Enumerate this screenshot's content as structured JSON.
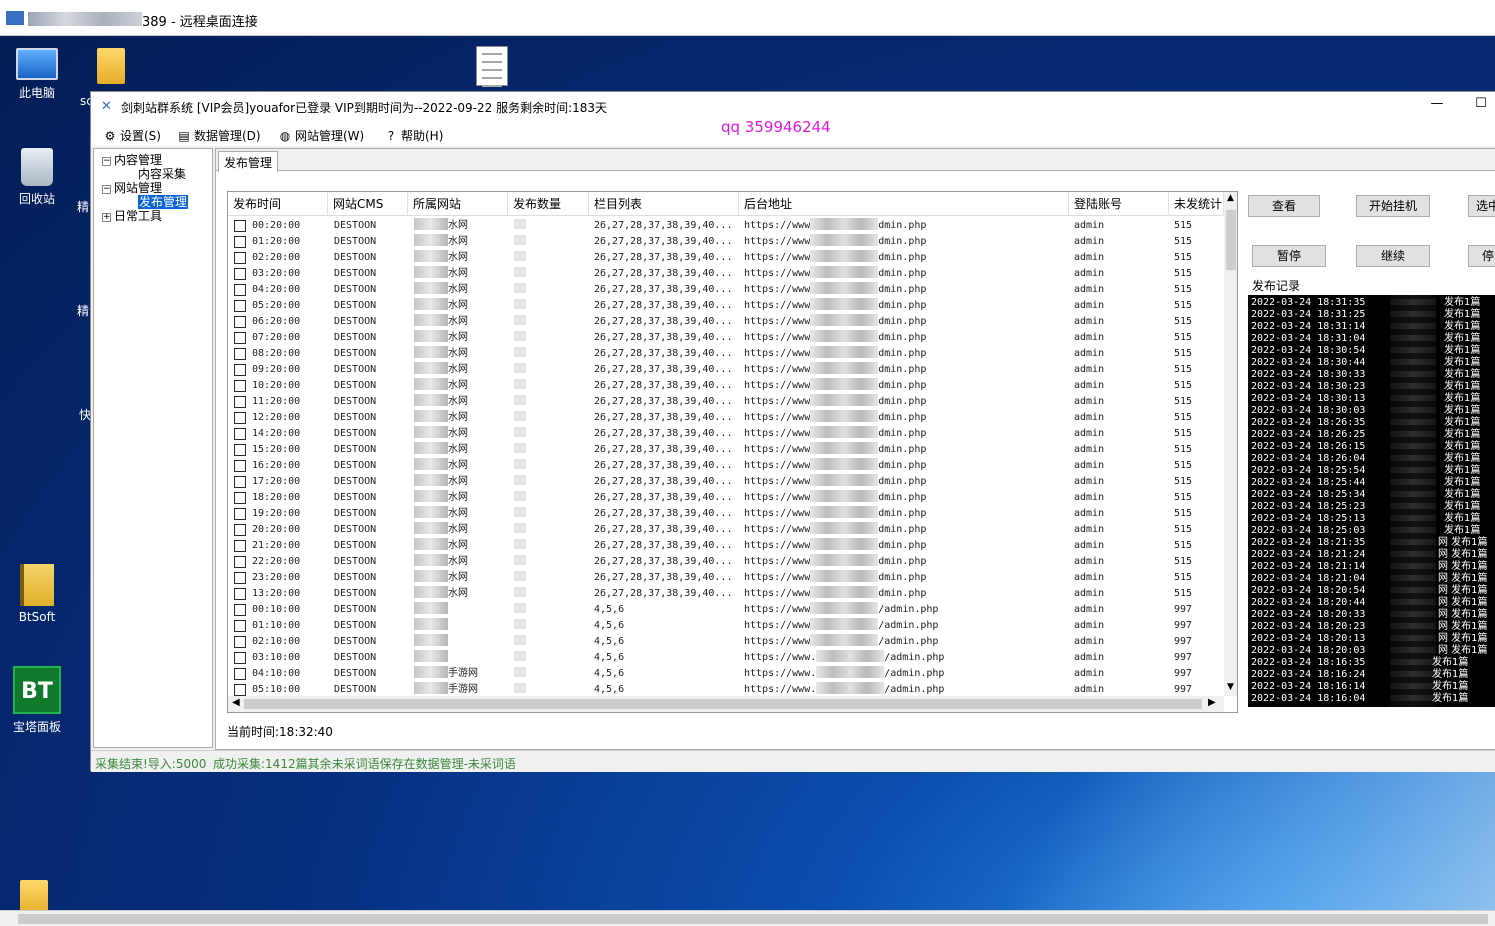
{
  "remote": {
    "title_suffix": "389 - 远程桌面连接"
  },
  "desktop": {
    "icons": [
      {
        "label": "此电脑"
      },
      {
        "label": "回收站"
      },
      {
        "label": "BtSoft"
      },
      {
        "label": "宝塔面板",
        "badge": "BT"
      }
    ],
    "partial_labels": [
      "sc",
      "精",
      "精",
      "快"
    ]
  },
  "app": {
    "title": "剑刺站群系统   [VIP会员]youafor已登录 VIP到期时间为--2022-09-22      服务剩余时间:183天",
    "min_glyph": "—",
    "max_glyph": "☐",
    "qq_watermark": "qq 359946244",
    "menu": [
      {
        "label": "设置(S)",
        "icon": "gear-icon",
        "glyph": "⚙"
      },
      {
        "label": "数据管理(D)",
        "icon": "database-icon",
        "glyph": "▤"
      },
      {
        "label": "网站管理(W)",
        "icon": "globe-icon",
        "glyph": "◍"
      },
      {
        "label": "帮助(H)",
        "icon": "help-icon",
        "glyph": "?"
      }
    ],
    "tree": {
      "nodes": [
        {
          "label": "内容管理",
          "expander": "−"
        },
        {
          "label": "内容采集"
        },
        {
          "label": "网站管理",
          "expander": "−"
        },
        {
          "label": "发布管理",
          "selected": true
        },
        {
          "label": "日常工具",
          "expander": "+"
        }
      ]
    },
    "tab_label": "发布管理",
    "grid": {
      "columns": [
        "发布时间",
        "网站CMS",
        "所属网站",
        "发布数量",
        "栏目列表",
        "后台地址",
        "登陆账号",
        "未发统计"
      ],
      "rows": [
        {
          "time": "00:20:00",
          "cms": "DESTOON",
          "site": "水网",
          "cats": "26,27,28,37,38,39,40...",
          "url_a": "https://www",
          "url_b": "dmin.php",
          "acct": "admin",
          "unsent": "515"
        },
        {
          "time": "01:20:00",
          "cms": "DESTOON",
          "site": "水网",
          "cats": "26,27,28,37,38,39,40...",
          "url_a": "https://www",
          "url_b": "dmin.php",
          "acct": "admin",
          "unsent": "515"
        },
        {
          "time": "02:20:00",
          "cms": "DESTOON",
          "site": "水网",
          "cats": "26,27,28,37,38,39,40...",
          "url_a": "https://www",
          "url_b": "dmin.php",
          "acct": "admin",
          "unsent": "515"
        },
        {
          "time": "03:20:00",
          "cms": "DESTOON",
          "site": "水网",
          "cats": "26,27,28,37,38,39,40...",
          "url_a": "https://www",
          "url_b": "dmin.php",
          "acct": "admin",
          "unsent": "515"
        },
        {
          "time": "04:20:00",
          "cms": "DESTOON",
          "site": "水网",
          "cats": "26,27,28,37,38,39,40...",
          "url_a": "https://www",
          "url_b": "dmin.php",
          "acct": "admin",
          "unsent": "515"
        },
        {
          "time": "05:20:00",
          "cms": "DESTOON",
          "site": "水网",
          "cats": "26,27,28,37,38,39,40...",
          "url_a": "https://www",
          "url_b": "dmin.php",
          "acct": "admin",
          "unsent": "515"
        },
        {
          "time": "06:20:00",
          "cms": "DESTOON",
          "site": "水网",
          "cats": "26,27,28,37,38,39,40...",
          "url_a": "https://www",
          "url_b": "dmin.php",
          "acct": "admin",
          "unsent": "515"
        },
        {
          "time": "07:20:00",
          "cms": "DESTOON",
          "site": "水网",
          "cats": "26,27,28,37,38,39,40...",
          "url_a": "https://www",
          "url_b": "dmin.php",
          "acct": "admin",
          "unsent": "515"
        },
        {
          "time": "08:20:00",
          "cms": "DESTOON",
          "site": "水网",
          "cats": "26,27,28,37,38,39,40...",
          "url_a": "https://www",
          "url_b": "dmin.php",
          "acct": "admin",
          "unsent": "515"
        },
        {
          "time": "09:20:00",
          "cms": "DESTOON",
          "site": "水网",
          "cats": "26,27,28,37,38,39,40...",
          "url_a": "https://www",
          "url_b": "dmin.php",
          "acct": "admin",
          "unsent": "515"
        },
        {
          "time": "10:20:00",
          "cms": "DESTOON",
          "site": "水网",
          "cats": "26,27,28,37,38,39,40...",
          "url_a": "https://www",
          "url_b": "dmin.php",
          "acct": "admin",
          "unsent": "515"
        },
        {
          "time": "11:20:00",
          "cms": "DESTOON",
          "site": "水网",
          "cats": "26,27,28,37,38,39,40...",
          "url_a": "https://www",
          "url_b": "dmin.php",
          "acct": "admin",
          "unsent": "515"
        },
        {
          "time": "12:20:00",
          "cms": "DESTOON",
          "site": "水网",
          "cats": "26,27,28,37,38,39,40...",
          "url_a": "https://www",
          "url_b": "dmin.php",
          "acct": "admin",
          "unsent": "515"
        },
        {
          "time": "14:20:00",
          "cms": "DESTOON",
          "site": "水网",
          "cats": "26,27,28,37,38,39,40...",
          "url_a": "https://www",
          "url_b": "dmin.php",
          "acct": "admin",
          "unsent": "515"
        },
        {
          "time": "15:20:00",
          "cms": "DESTOON",
          "site": "水网",
          "cats": "26,27,28,37,38,39,40...",
          "url_a": "https://www",
          "url_b": "dmin.php",
          "acct": "admin",
          "unsent": "515"
        },
        {
          "time": "16:20:00",
          "cms": "DESTOON",
          "site": "水网",
          "cats": "26,27,28,37,38,39,40...",
          "url_a": "https://www",
          "url_b": "dmin.php",
          "acct": "admin",
          "unsent": "515"
        },
        {
          "time": "17:20:00",
          "cms": "DESTOON",
          "site": "水网",
          "cats": "26,27,28,37,38,39,40...",
          "url_a": "https://www",
          "url_b": "dmin.php",
          "acct": "admin",
          "unsent": "515"
        },
        {
          "time": "18:20:00",
          "cms": "DESTOON",
          "site": "水网",
          "cats": "26,27,28,37,38,39,40...",
          "url_a": "https://www",
          "url_b": "dmin.php",
          "acct": "admin",
          "unsent": "515"
        },
        {
          "time": "19:20:00",
          "cms": "DESTOON",
          "site": "水网",
          "cats": "26,27,28,37,38,39,40...",
          "url_a": "https://www",
          "url_b": "dmin.php",
          "acct": "admin",
          "unsent": "515"
        },
        {
          "time": "20:20:00",
          "cms": "DESTOON",
          "site": "水网",
          "cats": "26,27,28,37,38,39,40...",
          "url_a": "https://www",
          "url_b": "dmin.php",
          "acct": "admin",
          "unsent": "515"
        },
        {
          "time": "21:20:00",
          "cms": "DESTOON",
          "site": "水网",
          "cats": "26,27,28,37,38,39,40...",
          "url_a": "https://www",
          "url_b": "dmin.php",
          "acct": "admin",
          "unsent": "515"
        },
        {
          "time": "22:20:00",
          "cms": "DESTOON",
          "site": "水网",
          "cats": "26,27,28,37,38,39,40...",
          "url_a": "https://www",
          "url_b": "dmin.php",
          "acct": "admin",
          "unsent": "515"
        },
        {
          "time": "23:20:00",
          "cms": "DESTOON",
          "site": "水网",
          "cats": "26,27,28,37,38,39,40...",
          "url_a": "https://www",
          "url_b": "dmin.php",
          "acct": "admin",
          "unsent": "515"
        },
        {
          "time": "13:20:00",
          "cms": "DESTOON",
          "site": "水网",
          "cats": "26,27,28,37,38,39,40...",
          "url_a": "https://www",
          "url_b": "dmin.php",
          "acct": "admin",
          "unsent": "515"
        },
        {
          "time": "00:10:00",
          "cms": "DESTOON",
          "site": "",
          "cats": "4,5,6",
          "url_a": "https://www",
          "url_b": "/admin.php",
          "acct": "admin",
          "unsent": "997"
        },
        {
          "time": "01:10:00",
          "cms": "DESTOON",
          "site": "",
          "cats": "4,5,6",
          "url_a": "https://www",
          "url_b": "/admin.php",
          "acct": "admin",
          "unsent": "997"
        },
        {
          "time": "02:10:00",
          "cms": "DESTOON",
          "site": "",
          "cats": "4,5,6",
          "url_a": "https://www",
          "url_b": "/admin.php",
          "acct": "admin",
          "unsent": "997"
        },
        {
          "time": "03:10:00",
          "cms": "DESTOON",
          "site": "",
          "cats": "4,5,6",
          "url_a": "https://www.",
          "url_b": "/admin.php",
          "acct": "admin",
          "unsent": "997"
        },
        {
          "time": "04:10:00",
          "cms": "DESTOON",
          "site": "手游网",
          "cats": "4,5,6",
          "url_a": "https://www.",
          "url_b": "/admin.php",
          "acct": "admin",
          "unsent": "997"
        },
        {
          "time": "05:10:00",
          "cms": "DESTOON",
          "site": "手游网",
          "cats": "4,5,6",
          "url_a": "https://www.",
          "url_b": "/admin.php",
          "acct": "admin",
          "unsent": "997"
        }
      ]
    },
    "current_time": "当前时间:18:32:40",
    "buttons": {
      "view": "查看",
      "start": "开始挂机",
      "select": "选中",
      "pause": "暂停",
      "resume": "继续",
      "stop": "停"
    },
    "log_label": "发布记录",
    "log": [
      {
        "ts": "2022-03-24 18:31:35",
        "msg": "发布1篇"
      },
      {
        "ts": "2022-03-24 18:31:25",
        "msg": "发布1篇"
      },
      {
        "ts": "2022-03-24 18:31:14",
        "msg": "发布1篇"
      },
      {
        "ts": "2022-03-24 18:31:04",
        "msg": "发布1篇"
      },
      {
        "ts": "2022-03-24 18:30:54",
        "msg": "发布1篇"
      },
      {
        "ts": "2022-03-24 18:30:44",
        "msg": "发布1篇"
      },
      {
        "ts": "2022-03-24 18:30:33",
        "msg": "发布1篇"
      },
      {
        "ts": "2022-03-24 18:30:23",
        "msg": "发布1篇"
      },
      {
        "ts": "2022-03-24 18:30:13",
        "msg": "发布1篇"
      },
      {
        "ts": "2022-03-24 18:30:03",
        "msg": "发布1篇"
      },
      {
        "ts": "2022-03-24 18:26:35",
        "msg": "发布1篇"
      },
      {
        "ts": "2022-03-24 18:26:25",
        "msg": "发布1篇"
      },
      {
        "ts": "2022-03-24 18:26:15",
        "msg": "发布1篇"
      },
      {
        "ts": "2022-03-24 18:26:04",
        "msg": "发布1篇"
      },
      {
        "ts": "2022-03-24 18:25:54",
        "msg": "发布1篇"
      },
      {
        "ts": "2022-03-24 18:25:44",
        "msg": "发布1篇"
      },
      {
        "ts": "2022-03-24 18:25:34",
        "msg": "发布1篇"
      },
      {
        "ts": "2022-03-24 18:25:23",
        "msg": "发布1篇"
      },
      {
        "ts": "2022-03-24 18:25:13",
        "msg": "发布1篇"
      },
      {
        "ts": "2022-03-24 18:25:03",
        "msg": "发布1篇"
      },
      {
        "ts": "2022-03-24 18:21:35",
        "msg": "网 发布1篇"
      },
      {
        "ts": "2022-03-24 18:21:24",
        "msg": "网 发布1篇"
      },
      {
        "ts": "2022-03-24 18:21:14",
        "msg": "网 发布1篇"
      },
      {
        "ts": "2022-03-24 18:21:04",
        "msg": "网 发布1篇"
      },
      {
        "ts": "2022-03-24 18:20:54",
        "msg": "网 发布1篇"
      },
      {
        "ts": "2022-03-24 18:20:44",
        "msg": "网 发布1篇"
      },
      {
        "ts": "2022-03-24 18:20:33",
        "msg": "网 发布1篇"
      },
      {
        "ts": "2022-03-24 18:20:23",
        "msg": "网 发布1篇"
      },
      {
        "ts": "2022-03-24 18:20:13",
        "msg": "网 发布1篇"
      },
      {
        "ts": "2022-03-24 18:20:03",
        "msg": "网 发布1篇"
      },
      {
        "ts": "2022-03-24 18:16:35",
        "msg": "发布1篇"
      },
      {
        "ts": "2022-03-24 18:16:24",
        "msg": "发布1篇"
      },
      {
        "ts": "2022-03-24 18:16:14",
        "msg": "发布1篇"
      },
      {
        "ts": "2022-03-24 18:16:04",
        "msg": "发布1篇"
      }
    ],
    "status": {
      "left": "采集结束!导入:5000",
      "right": "成功采集:1412篇其余未采词语保存在数据管理-未采词语"
    }
  }
}
